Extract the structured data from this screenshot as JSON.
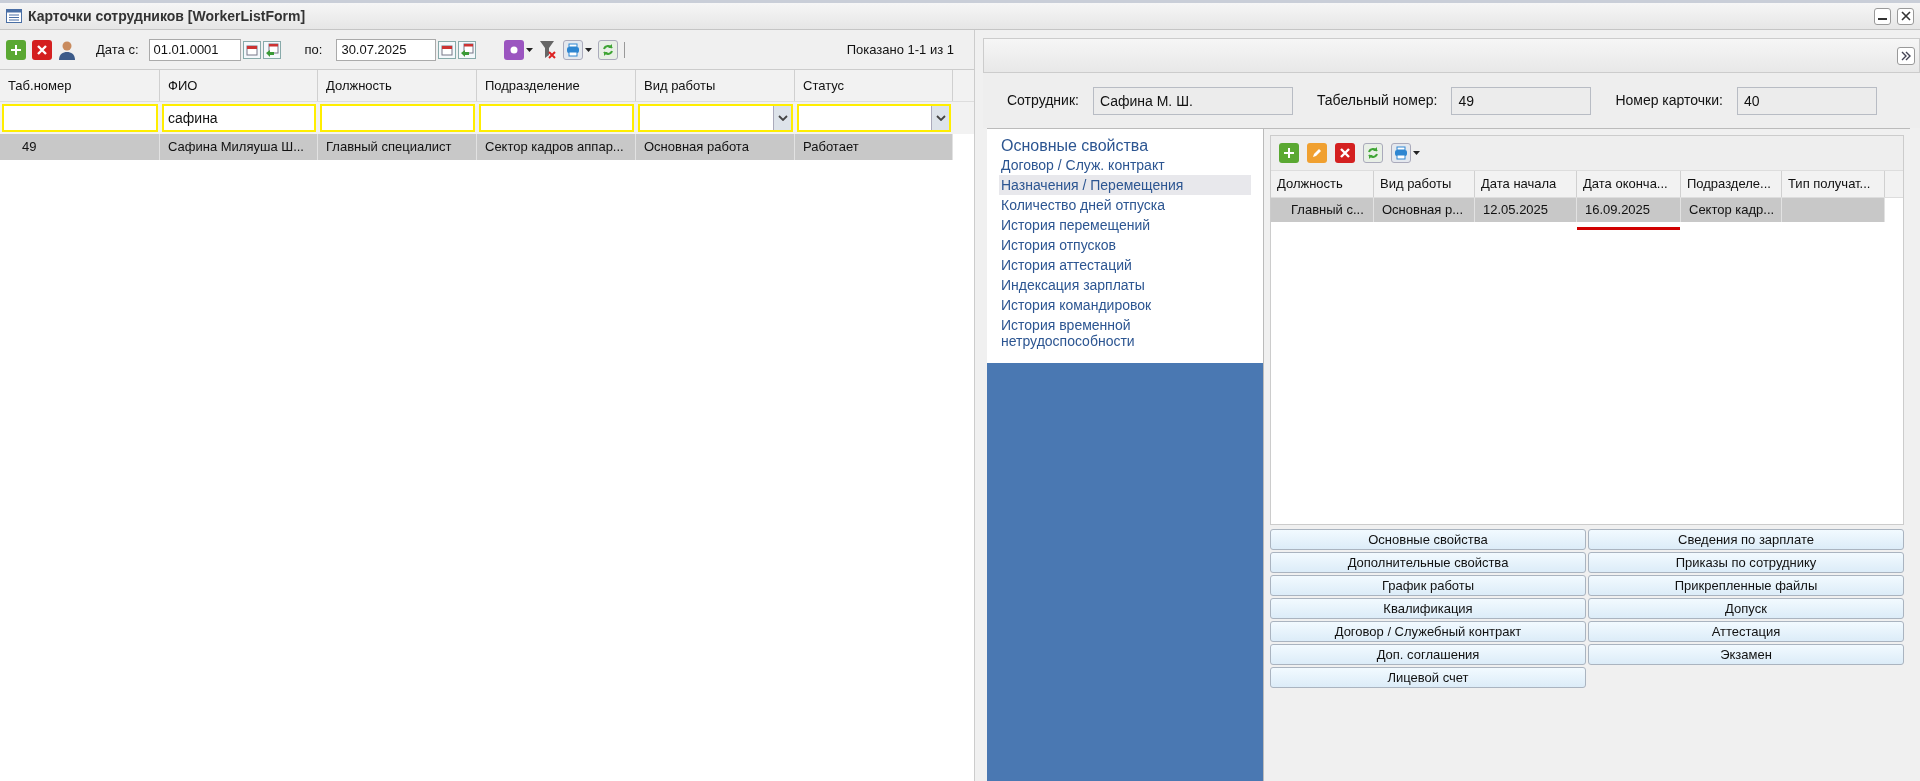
{
  "window": {
    "title": "Карточки сотрудников [WorkerListForm]"
  },
  "toolbar": {
    "date_from_label": "Дата с:",
    "date_from": "01.01.0001",
    "date_to_label": "по:",
    "date_to": "30.07.2025",
    "count": "Показано 1-1 из 1"
  },
  "table": {
    "columns": [
      "Таб.номер",
      "ФИО",
      "Должность",
      "Подразделение",
      "Вид работы",
      "Статус"
    ],
    "filters": [
      {
        "kind": "text"
      },
      {
        "kind": "text",
        "value": "сафина"
      },
      {
        "kind": "text"
      },
      {
        "kind": "text"
      },
      {
        "kind": "select"
      },
      {
        "kind": "select"
      }
    ],
    "rows": [
      {
        "selected": true,
        "cells": [
          "49",
          "Сафина Миляуша Ш...",
          "Главный специалист",
          "Сектор кадров аппар...",
          "Основная работа",
          "Работает"
        ]
      }
    ]
  },
  "details": {
    "fields": [
      {
        "label": "Сотрудник:",
        "value": "Сафина М. Ш."
      },
      {
        "label": "Табельный номер:",
        "value": "49"
      },
      {
        "label": "Номер карточки:",
        "value": "40"
      }
    ],
    "nav": [
      {
        "label": "Основные свойства",
        "selected": false,
        "heading": true
      },
      {
        "label": "Договор / Служ. контракт",
        "selected": false
      },
      {
        "label": "Назначения / Перемещения",
        "selected": true
      },
      {
        "label": "Количество дней отпуска",
        "selected": false
      },
      {
        "label": "История перемещений",
        "selected": false
      },
      {
        "label": "История отпусков",
        "selected": false
      },
      {
        "label": "История аттестаций",
        "selected": false
      },
      {
        "label": "Индексация зарплаты",
        "selected": false
      },
      {
        "label": "История командировок",
        "selected": false
      },
      {
        "label": "История временной нетрудоспособности",
        "selected": false
      }
    ],
    "grid": {
      "columns": [
        "Должность",
        "Вид работы",
        "Дата начала",
        "Дата оконча...",
        "Подразделе...",
        "Тип получат..."
      ],
      "rows": [
        {
          "selected": true,
          "cells": [
            {
              "text": "Главный с..."
            },
            {
              "text": "Основная р..."
            },
            {
              "text": "12.05.2025"
            },
            {
              "text": "16.09.2025",
              "underlined": true
            },
            {
              "text": "Сектор кадр..."
            }
          ]
        }
      ]
    },
    "buttons": [
      "Основные свойства",
      "Сведения по зарплате",
      "Дополнительные свойства",
      "Приказы по сотруднику",
      "График работы",
      "Прикрепленные файлы",
      "Квалификация",
      "Допуск",
      "Договор / Служебный контракт",
      "Аттестация",
      "Доп. соглашения",
      "Экзамен",
      "Лицевой счет"
    ]
  }
}
